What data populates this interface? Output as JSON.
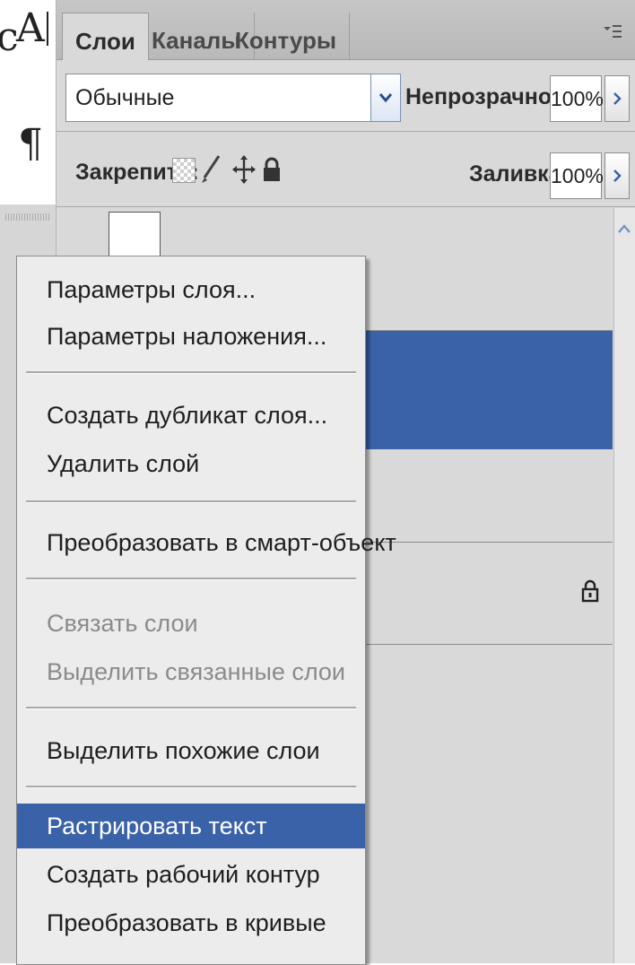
{
  "toolbar": {
    "type_tool_glyph": "A",
    "paragraph_glyph": "¶",
    "partial_glyph": "c"
  },
  "panel": {
    "tabs": [
      {
        "label": "Слои",
        "active": true
      },
      {
        "label": "Каналы",
        "active": false
      },
      {
        "label": "Контуры",
        "active": false
      }
    ],
    "blend_mode": "Обычные",
    "opacity_label": "Непрозрачность:",
    "opacity_value": "100%",
    "lock_label": "Закрепить:",
    "fill_label": "Заливка:",
    "fill_value": "100%"
  },
  "context_menu": {
    "items": [
      {
        "label": "Параметры слоя...",
        "enabled": true
      },
      {
        "label": "Параметры наложения...",
        "enabled": true
      },
      {
        "label": "Создать дубликат слоя...",
        "enabled": true
      },
      {
        "label": "Удалить слой",
        "enabled": true
      },
      {
        "label": "Преобразовать в смарт-объект",
        "enabled": true
      },
      {
        "label": "Связать слои",
        "enabled": false
      },
      {
        "label": "Выделить связанные слои",
        "enabled": false
      },
      {
        "label": "Выделить похожие слои",
        "enabled": true
      },
      {
        "label": "Растрировать текст",
        "enabled": true,
        "highlighted": true
      },
      {
        "label": "Создать рабочий контур",
        "enabled": true
      },
      {
        "label": "Преобразовать в кривые",
        "enabled": true
      }
    ]
  },
  "colors": {
    "highlight": "#3a62a8",
    "panel_bg": "#d9d9d9",
    "menu_bg": "#ececec"
  }
}
